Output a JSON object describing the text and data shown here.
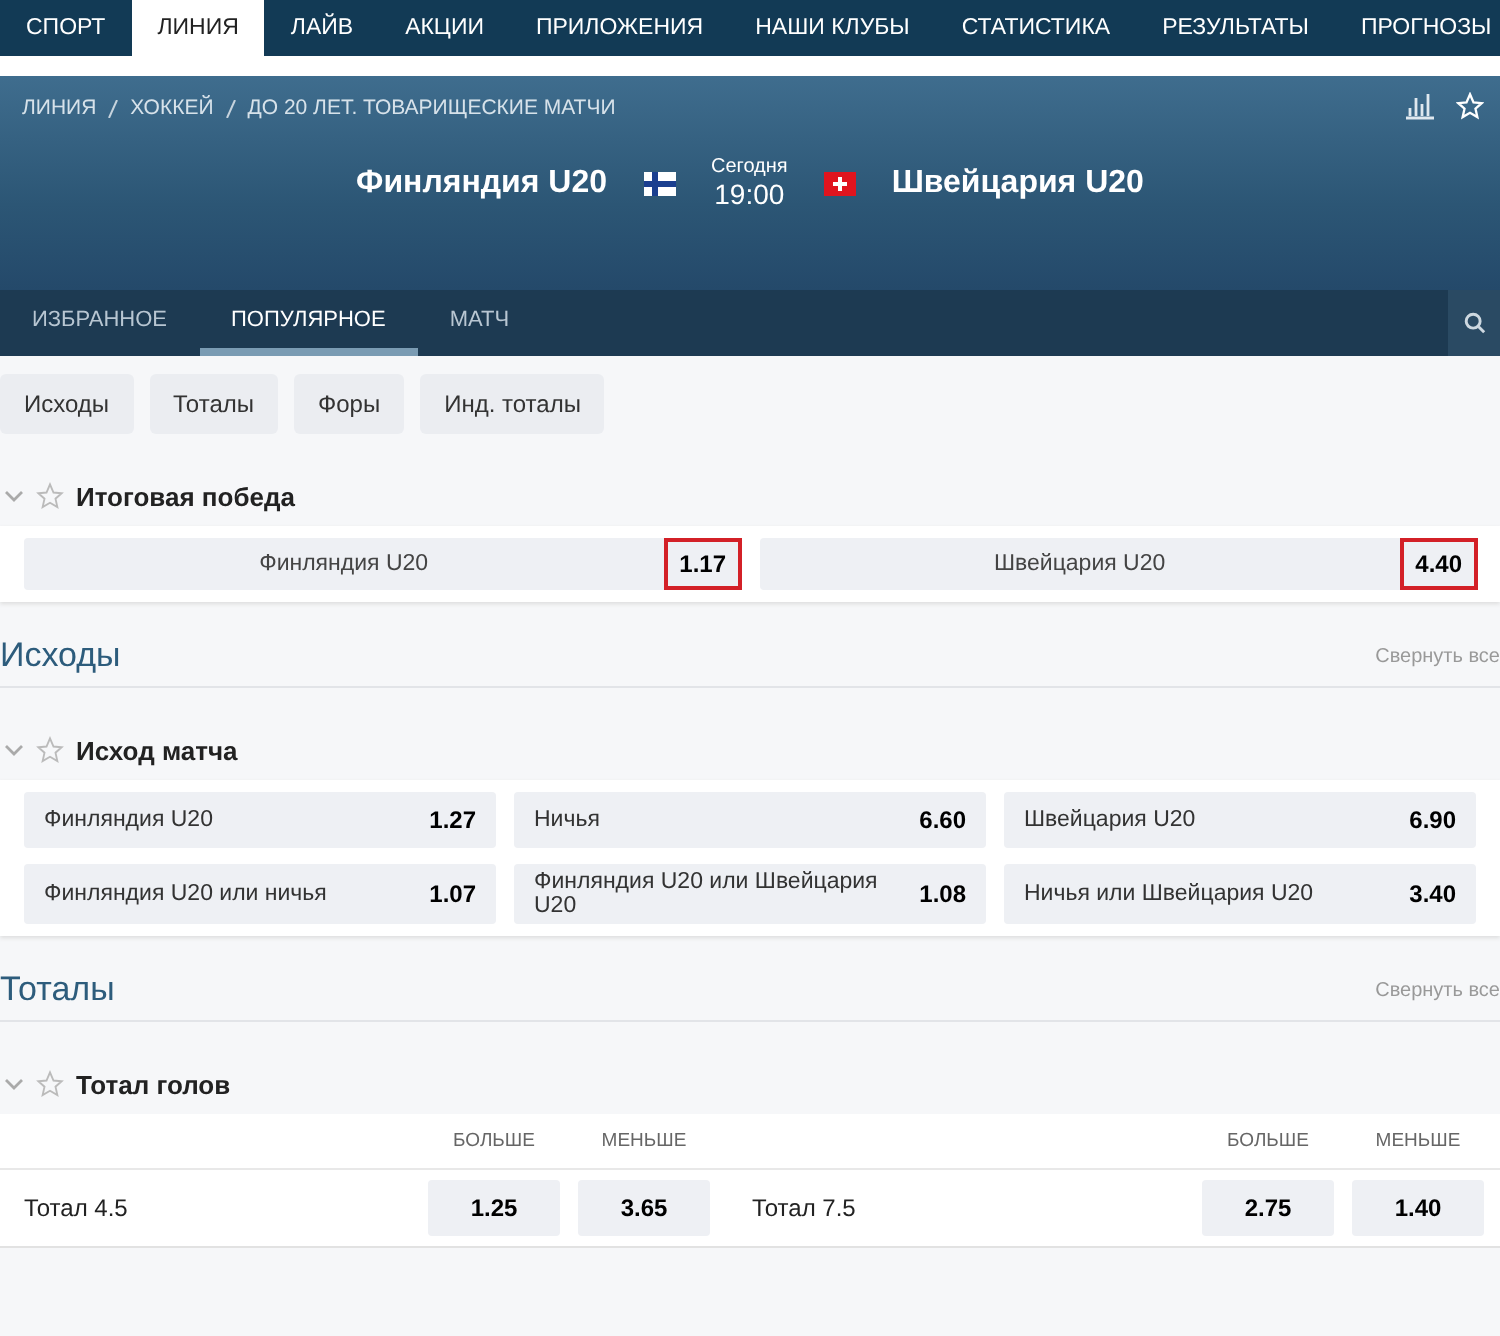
{
  "top_nav": [
    {
      "label": "СПОРТ",
      "selected": false
    },
    {
      "label": "ЛИНИЯ",
      "selected": true
    },
    {
      "label": "ЛАЙВ",
      "selected": false
    },
    {
      "label": "АКЦИИ",
      "selected": false
    },
    {
      "label": "ПРИЛОЖЕНИЯ",
      "selected": false
    },
    {
      "label": "НАШИ КЛУБЫ",
      "selected": false
    },
    {
      "label": "СТАТИСТИКА",
      "selected": false
    },
    {
      "label": "РЕЗУЛЬТАТЫ",
      "selected": false
    },
    {
      "label": "ПРОГНОЗЫ",
      "selected": false
    }
  ],
  "breadcrumbs": [
    "ЛИНИЯ",
    "ХОККЕЙ",
    "ДО 20 ЛЕТ. ТОВАРИЩЕСКИЕ МАТЧИ"
  ],
  "match": {
    "home": "Финляндия U20",
    "away": "Швейцария U20",
    "day": "Сегодня",
    "time": "19:00"
  },
  "sub_tabs": [
    {
      "label": "ИЗБРАННОЕ",
      "selected": false
    },
    {
      "label": "ПОПУЛЯРНОЕ",
      "selected": true
    },
    {
      "label": "МАТЧ",
      "selected": false
    }
  ],
  "filters": [
    "Исходы",
    "Тоталы",
    "Форы",
    "Инд. тоталы"
  ],
  "final_win": {
    "title": "Итоговая победа",
    "bets": [
      {
        "name": "Финляндия U20",
        "odd": "1.17",
        "highlighted": true
      },
      {
        "name": "Швейцария U20",
        "odd": "4.40",
        "highlighted": true
      }
    ]
  },
  "outcomes": {
    "title": "Исходы",
    "collapse": "Свернуть все",
    "market": "Исход матча",
    "rows": [
      [
        {
          "name": "Финляндия U20",
          "odd": "1.27"
        },
        {
          "name": "Ничья",
          "odd": "6.60"
        },
        {
          "name": "Швейцария U20",
          "odd": "6.90"
        }
      ],
      [
        {
          "name": "Финляндия U20 или ничья",
          "odd": "1.07"
        },
        {
          "name": "Финляндия U20 или Швейцария U20",
          "odd": "1.08"
        },
        {
          "name": "Ничья или Швейцария U20",
          "odd": "3.40"
        }
      ]
    ]
  },
  "totals": {
    "title": "Тоталы",
    "collapse": "Свернуть все",
    "market": "Тотал голов",
    "columns": [
      "БОЛЬШЕ",
      "МЕНЬШЕ",
      "БОЛЬШЕ",
      "МЕНЬШЕ"
    ],
    "lines": [
      {
        "name": "Тотал 4.5",
        "over": "1.25",
        "under": "3.65"
      },
      {
        "name": "Тотал 7.5",
        "over": "2.75",
        "under": "1.40"
      }
    ]
  }
}
